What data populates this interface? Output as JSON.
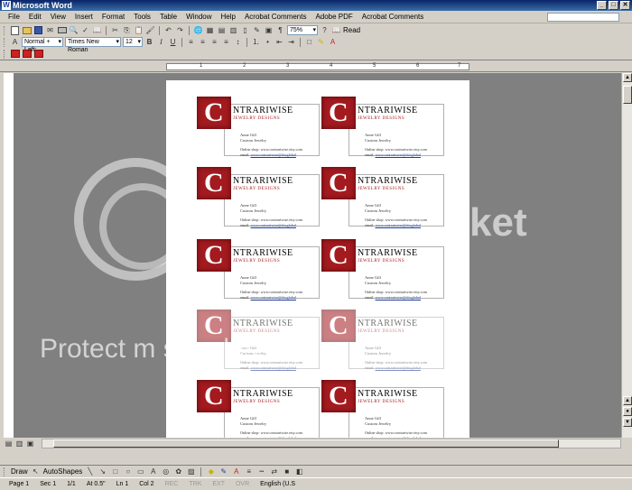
{
  "window": {
    "title": "Microsoft Word"
  },
  "menu": [
    "File",
    "Edit",
    "View",
    "Insert",
    "Format",
    "Tools",
    "Table",
    "Window",
    "Help",
    "Acrobat Comments",
    "Adobe PDF",
    "Acrobat Comments"
  ],
  "toolbar": {
    "zoom": "75%",
    "read_label": "Read",
    "style_value": "Normal + Left:",
    "font_value": "Times New Roman",
    "size_value": "12",
    "bold_label": "B",
    "italic_label": "I",
    "underline_label": "U"
  },
  "ruler": {
    "marks": [
      "1",
      "2",
      "3",
      "4",
      "5",
      "6",
      "7"
    ]
  },
  "cards": [
    {
      "letter": "C",
      "brand": "NTRARIWISE",
      "tagline": "JEWELRY DESIGNS",
      "name": "Anne Gill",
      "title": "Custom Jewelry",
      "shop": "Online shop: www.contrariwise.etsy.com",
      "email_label": "email:",
      "email": "www.contrariwise@sbcglobal"
    }
  ],
  "drawbar": {
    "draw_label": "Draw",
    "autoshapes_label": "AutoShapes"
  },
  "status": {
    "page": "Page 1",
    "sec": "Sec 1",
    "pages": "1/1",
    "at": "At 0.5\"",
    "ln": "Ln 1",
    "col": "Col 2",
    "rec": "REC",
    "trk": "TRK",
    "ext": "EXT",
    "ovr": "OVR",
    "lang": "English (U.S"
  },
  "watermark": {
    "brand_fragment": "ket",
    "message": "Protect m                                             s for less!"
  },
  "colors": {
    "logo_red": "#a31a1f",
    "workspace": "#808080",
    "title_blue": "#0a246a"
  }
}
